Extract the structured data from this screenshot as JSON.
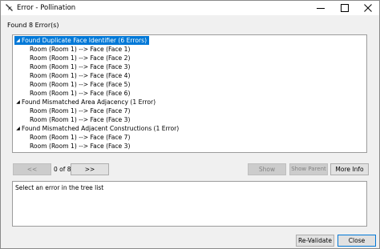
{
  "window": {
    "title": "Error - Pollination",
    "icon": "pollination-bee-icon"
  },
  "found_label": "Found 8 Error(s)",
  "tree": {
    "groups": [
      {
        "label": "Found Duplicate Face Identifier (6 Errors)",
        "expanded": true,
        "selected": true,
        "children": [
          "Room (Room 1) --> Face (Face 1)",
          "Room (Room 1) --> Face (Face 2)",
          "Room (Room 1) --> Face (Face 3)",
          "Room (Room 1) --> Face (Face 4)",
          "Room (Room 1) --> Face (Face 5)",
          "Room (Room 1) --> Face (Face 6)"
        ]
      },
      {
        "label": "Found Mismatched Area Adjacency (1 Error)",
        "expanded": true,
        "selected": false,
        "children": [
          "Room (Room 1) --> Face (Face 7)",
          "Room (Room 1) --> Face (Face 3)"
        ]
      },
      {
        "label": "Found Mismatched Adjacent Constructions (1 Error)",
        "expanded": true,
        "selected": false,
        "children": [
          "Room (Room 1) --> Face (Face 7)",
          "Room (Room 1) --> Face (Face 3)"
        ]
      }
    ]
  },
  "pager": {
    "prev_label": "<<",
    "counter": "0 of 8",
    "next_label": ">>"
  },
  "actions": {
    "show_label": "Show",
    "show_parent_label": "Show Parent",
    "more_info_label": "More Info"
  },
  "details": {
    "text": "Select an error in the tree list"
  },
  "footer": {
    "revalidate_label": "Re-Validate",
    "close_label": "Close"
  },
  "colors": {
    "selection": "#0078d7",
    "window_bg": "#f0f0f0",
    "panel_bg": "#ffffff",
    "disabled_text": "#838383"
  }
}
